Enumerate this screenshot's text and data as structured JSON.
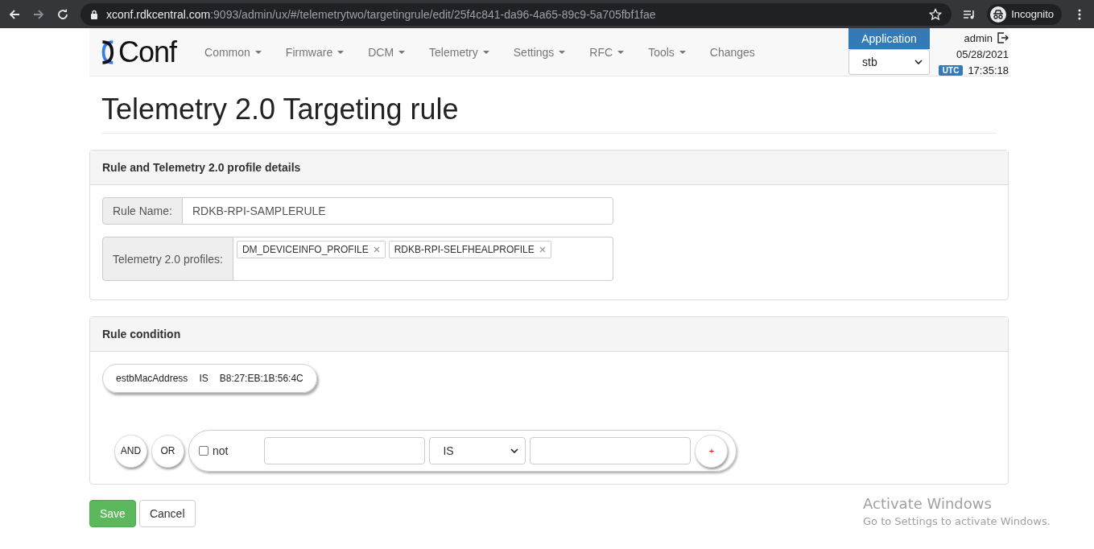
{
  "browser": {
    "url_host": "xconf.rdkcentral.com",
    "url_path": ":9093/admin/ux/#/telemetrytwo/targetingrule/edit/25f4c841-da96-4a65-89c9-5a705fbf1fae",
    "profile": "Incognito"
  },
  "navbar": {
    "logo": "Conf",
    "menus": [
      {
        "label": "Common",
        "dropdown": true
      },
      {
        "label": "Firmware",
        "dropdown": true
      },
      {
        "label": "DCM",
        "dropdown": true
      },
      {
        "label": "Telemetry",
        "dropdown": true
      },
      {
        "label": "Settings",
        "dropdown": true
      },
      {
        "label": "RFC",
        "dropdown": true
      },
      {
        "label": "Tools",
        "dropdown": true
      },
      {
        "label": "Changes",
        "dropdown": false
      }
    ],
    "application": {
      "label": "Application",
      "value": "stb"
    },
    "user": "admin",
    "date": "05/28/2021",
    "timezone": "UTC",
    "time": "17:35:18"
  },
  "page_title": "Telemetry 2.0 Targeting rule",
  "details": {
    "heading": "Rule and Telemetry 2.0 profile details",
    "rule_name_label": "Rule Name:",
    "rule_name": "RDKB-RPI-SAMPLERULE",
    "profiles_label": "Telemetry 2.0 profiles:",
    "profiles": [
      "DM_DEVICEINFO_PROFILE",
      "RDKB-RPI-SELFHEALPROFILE"
    ]
  },
  "condition": {
    "heading": "Rule condition",
    "rules": [
      {
        "key": "estbMacAddress",
        "operation": "IS",
        "value": "B8:27:EB:1B:56:4C"
      }
    ],
    "builder": {
      "buttons": [
        "AND",
        "OR"
      ],
      "not_checked": false,
      "not_label": "not",
      "operation": "IS",
      "add": "+"
    }
  },
  "actions": [
    "Save",
    "Cancel"
  ],
  "os_notice": {
    "title": "Activate Windows",
    "text": "Go to Settings to activate Windows."
  }
}
